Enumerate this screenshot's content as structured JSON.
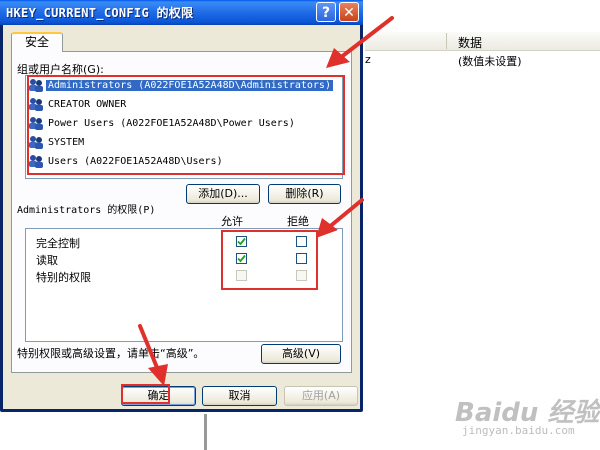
{
  "dialog": {
    "title": "HKEY_CURRENT_CONFIG 的权限",
    "help_btn": "?",
    "close_btn": "✕",
    "tab_label": "安全",
    "group_label": "组或用户名称(G):",
    "users": [
      {
        "name": "Administrators (A022FOE1A52A48D\\Administrators)",
        "selected": true
      },
      {
        "name": "CREATOR OWNER",
        "selected": false
      },
      {
        "name": "Power Users (A022FOE1A52A48D\\Power Users)",
        "selected": false
      },
      {
        "name": "SYSTEM",
        "selected": false
      },
      {
        "name": "Users (A022FOE1A52A48D\\Users)",
        "selected": false
      }
    ],
    "add_btn": "添加(D)...",
    "remove_btn": "删除(R)",
    "perm_label": "Administrators 的权限(P)",
    "allow_header": "允许",
    "deny_header": "拒绝",
    "permissions": [
      {
        "name": "完全控制",
        "allow": true,
        "deny": false,
        "enabled": true
      },
      {
        "name": "读取",
        "allow": true,
        "deny": false,
        "enabled": true
      },
      {
        "name": "特别的权限",
        "allow": false,
        "deny": false,
        "enabled": false
      }
    ],
    "note": "特别权限或高级设置，请单击“高级”。",
    "advanced_btn": "高级(V)",
    "ok_btn": "确定",
    "cancel_btn": "取消",
    "apply_btn": "应用(A)"
  },
  "background": {
    "column_header": "数据",
    "row_name_fragment": "z",
    "row_value": "(数值未设置)"
  },
  "watermark": {
    "text": "Baidu 经验",
    "sub": "jingyan.baidu.com"
  },
  "colors": {
    "annotation": "#e0302b",
    "selection": "#316ac5",
    "titlebar": "#0a55d6"
  }
}
